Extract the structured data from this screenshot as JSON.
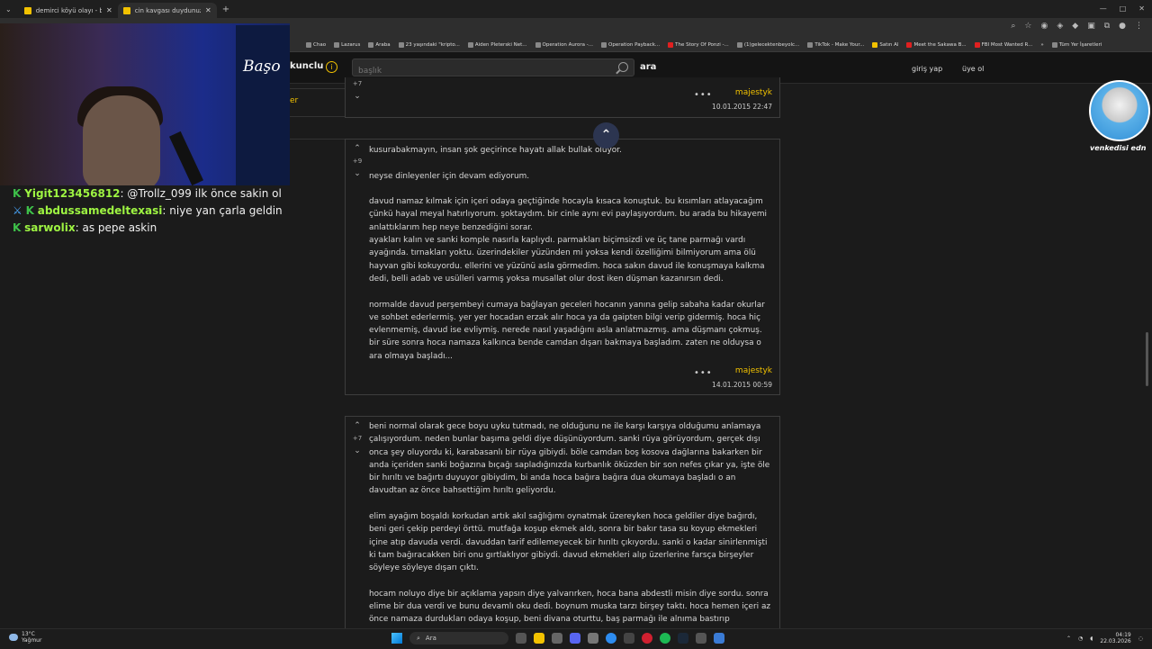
{
  "browser": {
    "tabs": [
      {
        "title": "demirci köyü olayı - başlığı açan..."
      },
      {
        "title": "cin kavgası duydunuz mu hiç - ..."
      }
    ],
    "window_controls": [
      "—",
      "□",
      "✕"
    ],
    "bookmarks": [
      {
        "label": "Chao"
      },
      {
        "label": "Lazarus"
      },
      {
        "label": "Araba"
      },
      {
        "label": "23 yaşındaki \"kripto..."
      },
      {
        "label": "Aiden Pleterski Net..."
      },
      {
        "label": "Operation Aurora -..."
      },
      {
        "label": "Operation Payback..."
      },
      {
        "label": "The Story Of Ponzi -..."
      },
      {
        "label": "(1)gelecektenbeyolc..."
      },
      {
        "label": "TikTok - Make Your..."
      },
      {
        "label": "Satın Al"
      },
      {
        "label": "Meet the Sakawa B..."
      },
      {
        "label": "FBI Most Wanted R..."
      },
      {
        "label": "Tüm Yer İşaretleri"
      }
    ]
  },
  "site": {
    "logo_fragment": "kunclu",
    "search_placeholder": "başlık",
    "search_button": "ara",
    "login": "giriş yap",
    "signup": "üye ol",
    "left_label": "er"
  },
  "entries": [
    {
      "votes": "+7",
      "paragraphs": [],
      "author": "majestyk",
      "date": "10.01.2015 22:47"
    },
    {
      "votes": "+9",
      "paragraphs": [
        "kusurabakmayın, insan şok geçirince hayatı allak bullak oluyor.",
        "neyse dinleyenler için devam ediyorum.",
        "davud namaz kılmak için içeri odaya geçtiğinde hocayla kısaca konuştuk. bu kısımları atlayacağım çünkü hayal meyal hatırlıyorum. şoktaydım. bir cinle aynı evi paylaşıyordum. bu arada bu hikayemi anlattıklarım hep neye benzediğini sorar.\nayakları kalın ve sanki komple nasırla kaplıydı. parmakları biçimsizdi ve üç tane parmağı vardı ayağında. tırnakları yoktu. üzerindekiler yüzünden mi yoksa kendi özelliğimi bilmiyorum ama ölü hayvan gibi kokuyordu. ellerini ve yüzünü asla görmedim. hoca sakın davud ile konuşmaya kalkma dedi, belli adab ve usülleri varmış yoksa musallat olur dost iken düşman kazanırsın dedi.",
        "normalde davud perşembeyi cumaya bağlayan geceleri hocanın yanına gelip sabaha kadar okurlar ve sohbet ederlermiş. yer yer hocadan erzak alır hoca ya da gaipten bilgi verip gidermiş. hoca hiç evlenmemiş, davud ise evliymiş. nerede nasıl yaşadığını asla anlatmazmış. ama düşmanı çokmuş. bir süre sonra hoca namaza kalkınca bende camdan dışarı bakmaya başladım. zaten ne olduysa o ara olmaya başladı..."
      ],
      "author": "majestyk",
      "date": "14.01.2015 00:59"
    },
    {
      "votes": "+7",
      "paragraphs": [
        "beni normal olarak gece boyu uyku tutmadı, ne olduğunu ne ile karşı karşıya olduğumu anlamaya çalışıyordum. neden bunlar başıma geldi diye düşünüyordum. sanki rüya görüyordum, gerçek dışı onca şey oluyordu ki, karabasanlı bir rüya gibiydi. böle camdan boş kosova dağlarına bakarken bir anda içeriden sanki boğazına bıçağı sapladığınızda kurbanlık öküzden bir son nefes çıkar ya, işte öle bir hırıltı ve bağırtı duyuyor gibiydim, bi anda hoca bağıra bağıra dua okumaya başladı o an davudtan az önce bahsettiğim hırıltı geliyordu.",
        "elim ayağım boşaldı korkudan artık akıl sağlığımı oynatmak üzereyken hoca geldiler diye bağırdı, beni geri çekip perdeyi örttü. mutfağa koşup ekmek aldı, sonra bir bakır tasa su koyup ekmekleri içine atıp davuda verdi. davuddan tarif edilemeyecek bir hırıltı çıkıyordu. sanki o kadar sinirlenmişti ki tam bağıracakken biri onu gırtlaklıyor gibiydi. davud ekmekleri alıp üzerlerine farsça birşeyler söyleye söyleye dışarı çıktı.",
        "hocam noluyo diye bir açıklama yapsın diye yalvarırken, hoca bana abdestli misin diye sordu. sonra elime bir dua verdi ve bunu devamlı oku dedi. boynum muska tarzı birşey taktı. hoca hemen içeri az önce namaza durdukları odaya koşup, beni divana oturttu, baş parmağı ile alnıma bastırıp"
      ]
    }
  ],
  "stream": {
    "overlay_logo": "Başo",
    "chat": [
      {
        "user": "Yigit123456812",
        "message": ": @Trollz_099 ilk önce sakin ol"
      },
      {
        "user": "abdussamedeltexasi",
        "message": ": niye yan çarla geldin"
      },
      {
        "user": "sarwolix",
        "message": ": as pepe askin"
      }
    ],
    "corner_label": "venkedisi edn"
  },
  "taskbar": {
    "weather_temp": "13°C",
    "weather_desc": "Yağmur",
    "search_label": "Ara",
    "time": "04:19",
    "date": "22.03.2026"
  }
}
